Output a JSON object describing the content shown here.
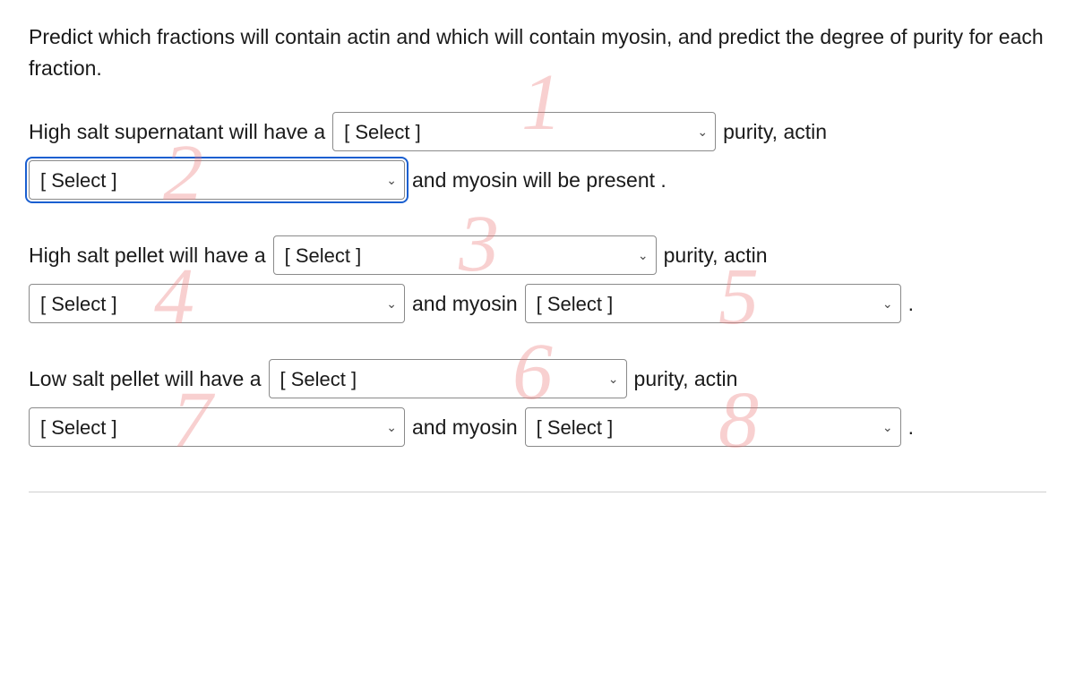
{
  "question": "Predict which fractions will contain actin and which will contain myosin, and predict the degree of purity for each fraction.",
  "placeholder": "[ Select ]",
  "text": {
    "hs_super_pre": "High salt supernatant will have a",
    "purity_actin": "purity, actin",
    "and_myosin_present": "and myosin will be present .",
    "hs_pellet_pre": "High salt pellet will have a",
    "and_myosin": "and myosin",
    "ls_pellet_pre": "Low salt pellet will have a",
    "period": "."
  },
  "watermarks": [
    "1",
    "2",
    "3",
    "4",
    "5",
    "6",
    "7",
    "8"
  ]
}
